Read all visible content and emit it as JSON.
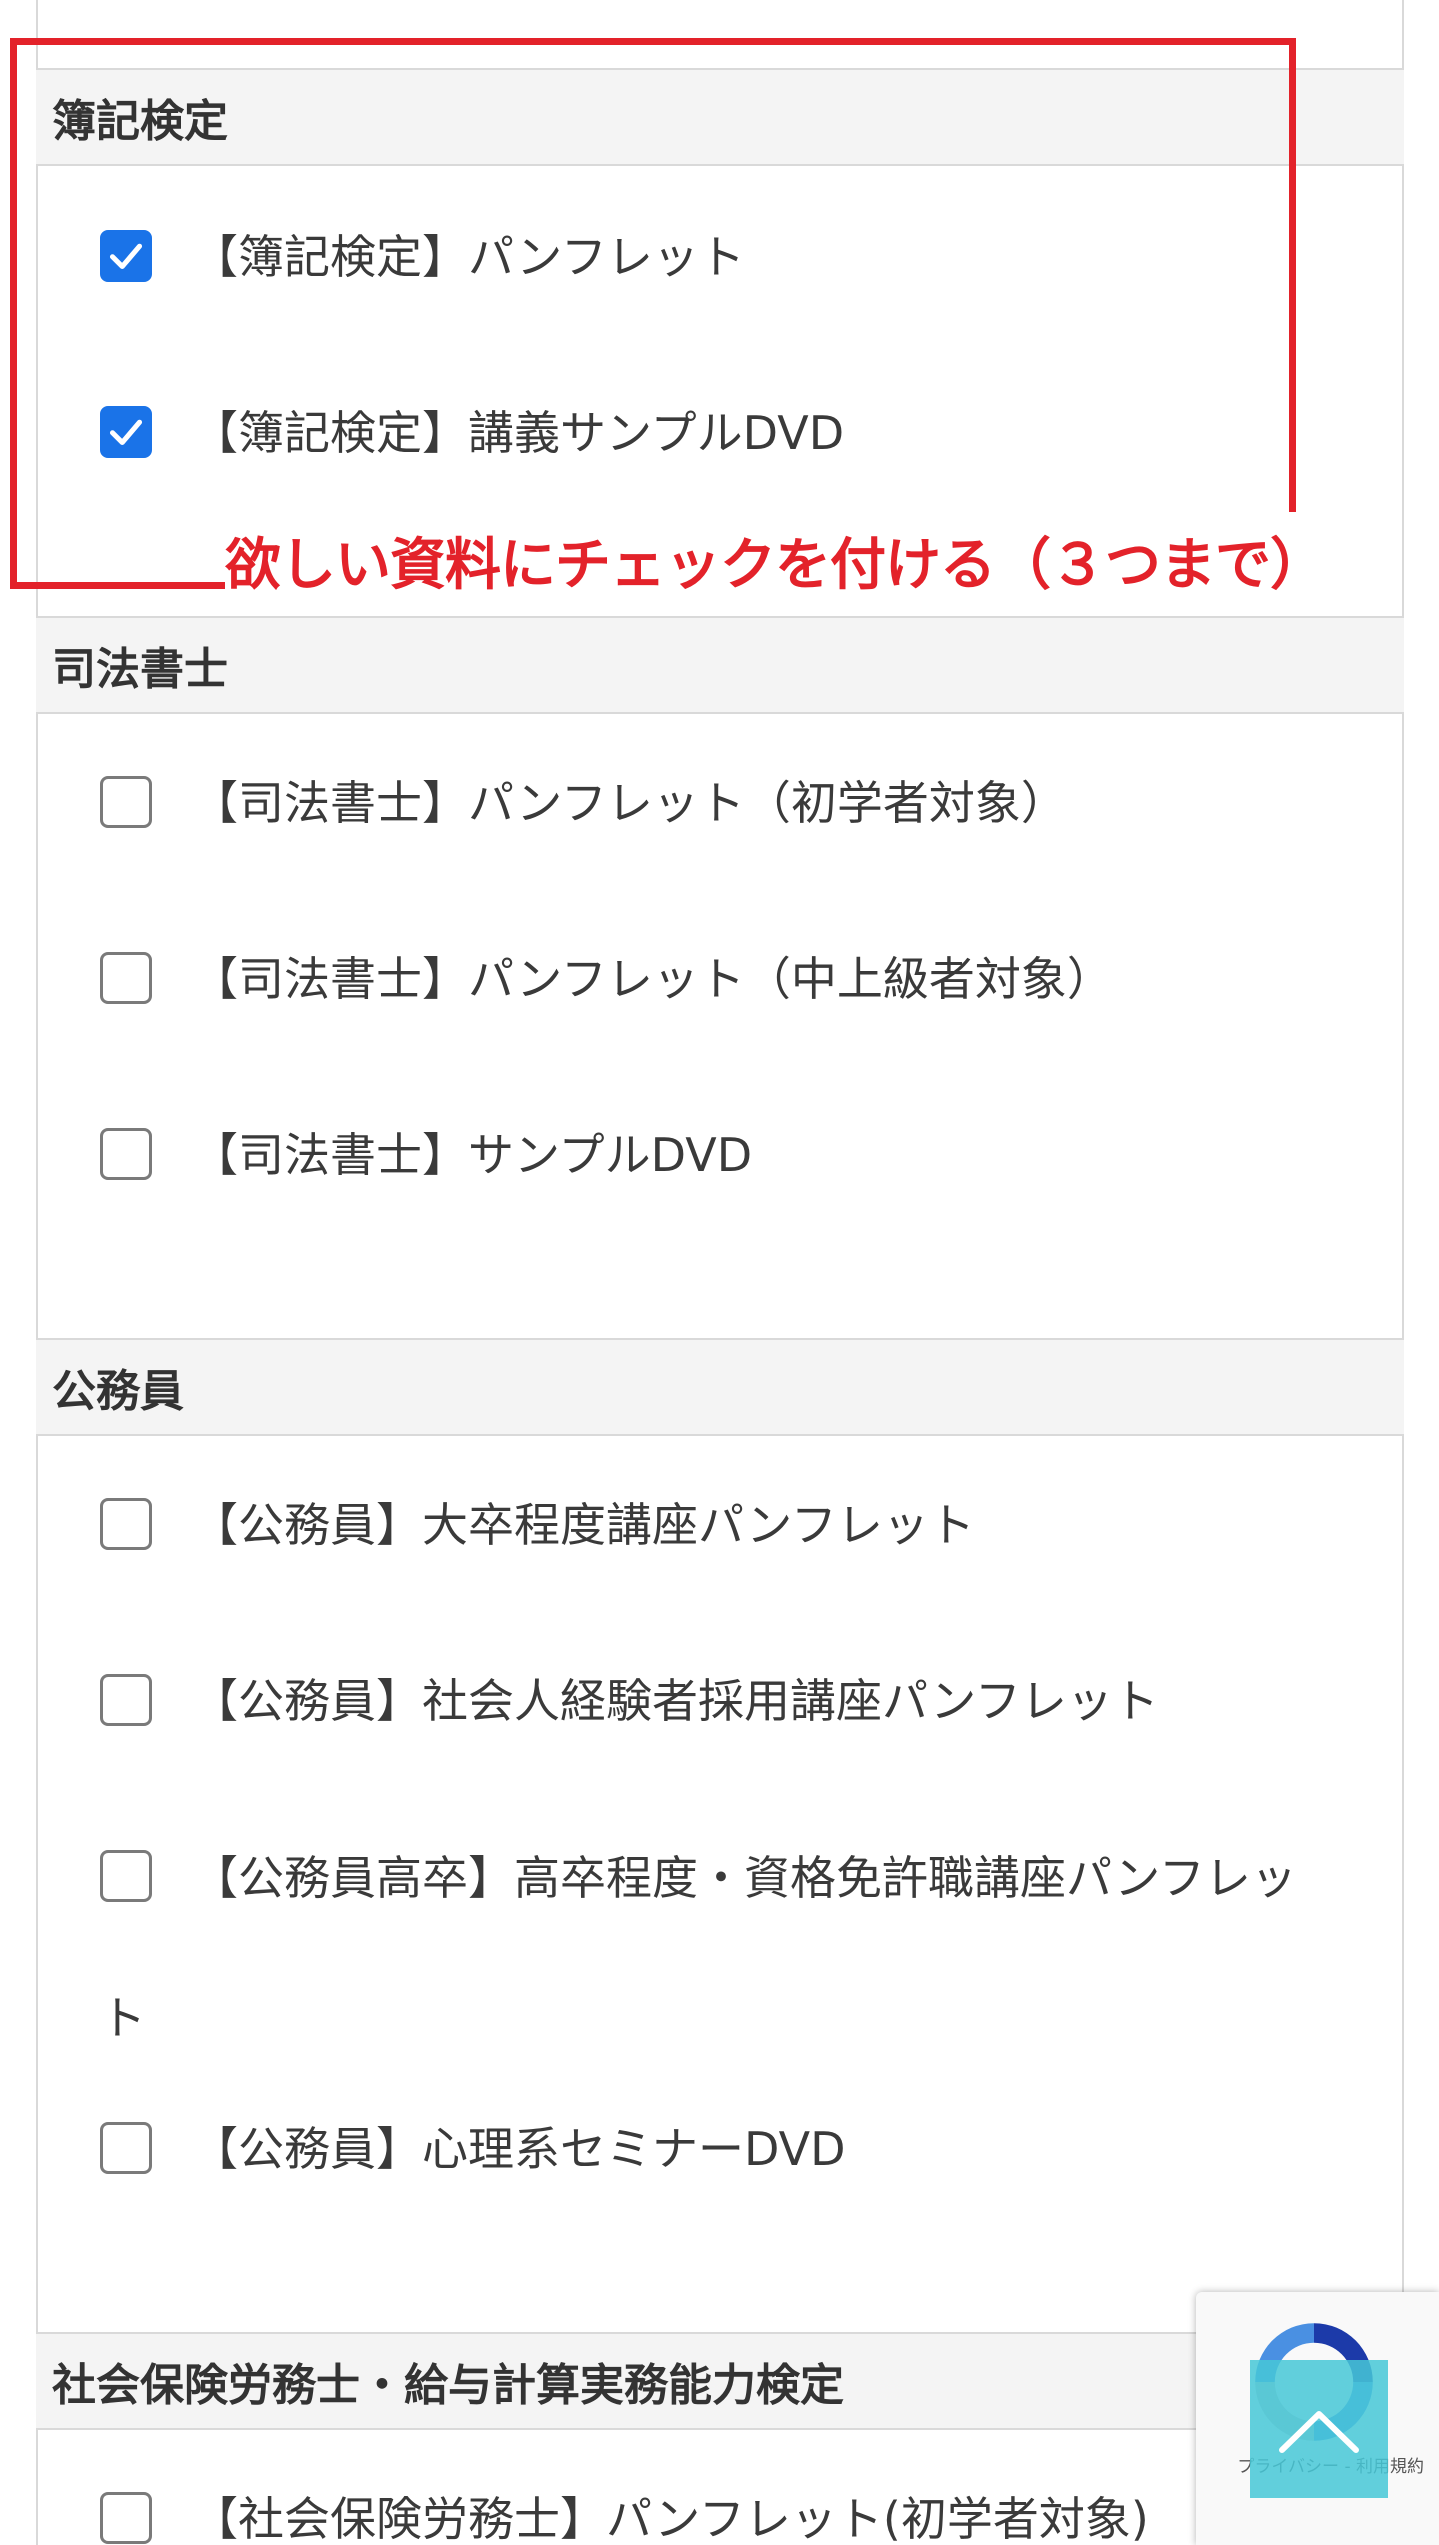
{
  "annotation": {
    "callout_text": "欲しい資料にチェックを付ける（３つまで）",
    "color": "#e3222a"
  },
  "sections": [
    {
      "title": "簿記検定",
      "options": [
        {
          "label": "【簿記検定】パンフレット",
          "checked": true
        },
        {
          "label": "【簿記検定】講義サンプルDVD",
          "checked": true
        }
      ]
    },
    {
      "title": "司法書士",
      "options": [
        {
          "label": "【司法書士】パンフレット（初学者対象）",
          "checked": false
        },
        {
          "label": "【司法書士】パンフレット（中上級者対象）",
          "checked": false
        },
        {
          "label": "【司法書士】サンプルDVD",
          "checked": false
        }
      ]
    },
    {
      "title": "公務員",
      "options": [
        {
          "label": "【公務員】大卒程度講座パンフレット",
          "checked": false
        },
        {
          "label": "【公務員】社会人経験者採用講座パンフレット",
          "checked": false
        },
        {
          "label": "【公務員高卒】高卒程度・資格免許職講座パンフレット",
          "checked": false
        },
        {
          "label": "【公務員】心理系セミナーDVD",
          "checked": false
        }
      ]
    },
    {
      "title": "社会保険労務士・給与計算実務能力検定",
      "options": [
        {
          "label": "【社会保険労務士】パンフレット(初学者対象)",
          "checked": false
        }
      ]
    }
  ],
  "recaptcha": {
    "footer_text": "プライバシー - 利用規約",
    "icon": "recaptcha-icon"
  },
  "back_to_top": {
    "icon": "chevron-up-icon",
    "color": "#46c8d7"
  },
  "checkbox_color": "#1a73e8"
}
